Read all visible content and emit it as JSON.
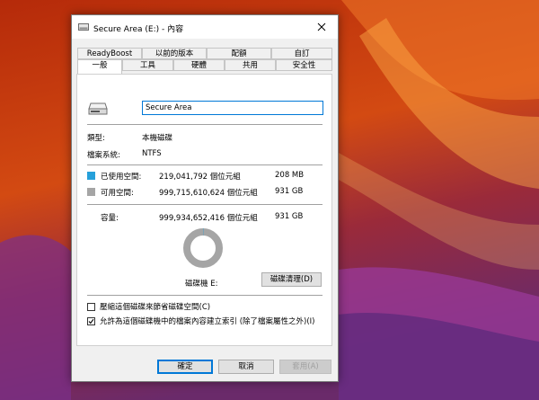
{
  "window": {
    "title": "Secure Area (E:) - 內容",
    "close_glyph": "✕"
  },
  "tabs": {
    "row_top": [
      {
        "label": "ReadyBoost"
      },
      {
        "label": "以前的版本"
      },
      {
        "label": "配額"
      },
      {
        "label": "自訂"
      }
    ],
    "row_bottom": [
      {
        "label": "一般",
        "active": true
      },
      {
        "label": "工具"
      },
      {
        "label": "硬體"
      },
      {
        "label": "共用"
      },
      {
        "label": "安全性"
      }
    ]
  },
  "general": {
    "volume_name": "Secure Area",
    "type_label": "類型:",
    "type_value": "本機磁碟",
    "fs_label": "檔案系統:",
    "fs_value": "NTFS",
    "used_label": "已使用空間:",
    "used_bytes": "219,041,792 個位元組",
    "used_size": "208 MB",
    "free_label": "可用空間:",
    "free_bytes": "999,715,610,624 個位元組",
    "free_size": "931 GB",
    "capacity_label": "容量:",
    "capacity_bytes": "999,934,652,416 個位元組",
    "capacity_size": "931 GB",
    "drive_label": "磁碟機 E:",
    "cleanup_button": "磁碟清理(D)",
    "compress_label": "壓縮這個磁碟來節省磁碟空間(C)",
    "compress_checked": false,
    "index_label": "允許為這個磁碟機中的檔案內容建立索引 (除了檔案屬性之外)(I)",
    "index_checked": true,
    "used_fraction": 0.000219
  },
  "buttons": {
    "ok": "確定",
    "cancel": "取消",
    "apply": "套用(A)"
  },
  "colors": {
    "used": "#26a0da",
    "free": "#a5a5a5",
    "accent": "#0078d7"
  },
  "icons": {
    "drive": "drive-icon",
    "close": "close-icon",
    "check": "checkmark-icon"
  }
}
